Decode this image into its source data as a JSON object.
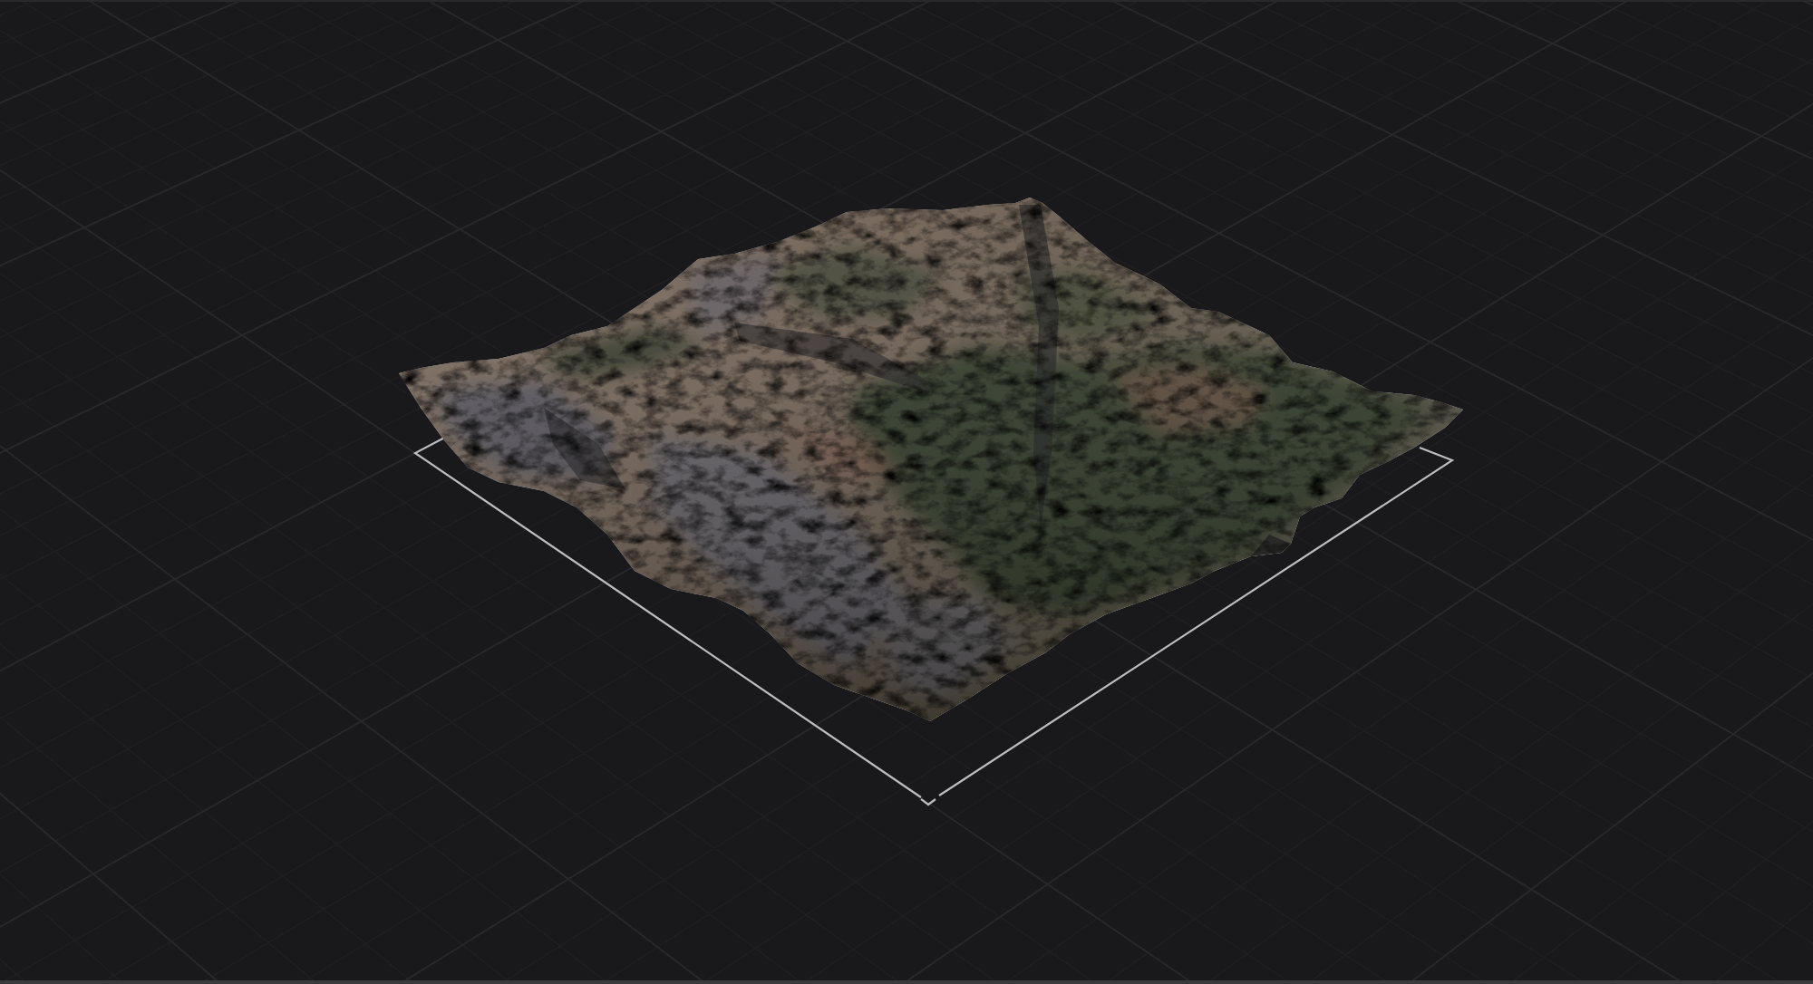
{
  "viewport": {
    "terrain": {
      "selected": true
    }
  }
}
